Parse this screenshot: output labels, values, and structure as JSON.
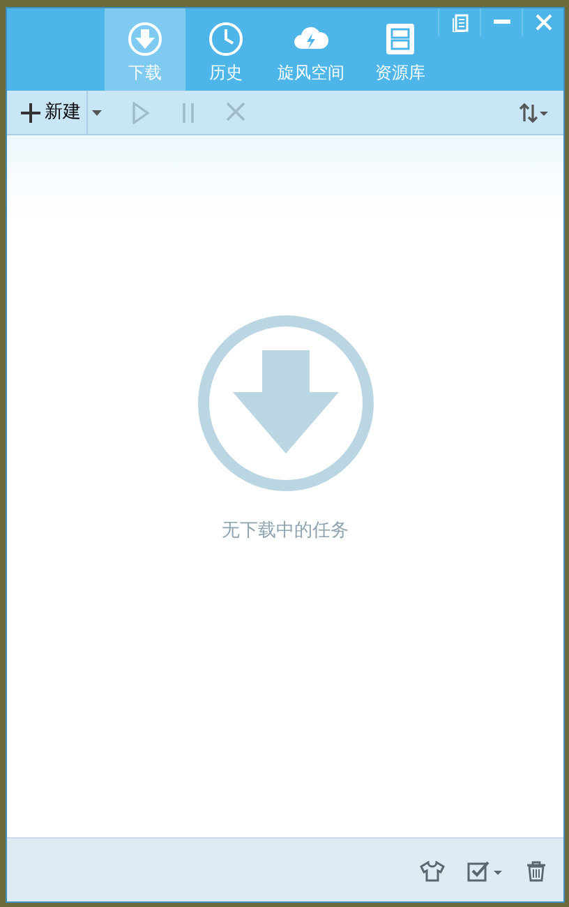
{
  "tabs": [
    {
      "label": "下载",
      "kind": "download",
      "selected": true
    },
    {
      "label": "历史",
      "kind": "history",
      "selected": false
    },
    {
      "label": "旋风空间",
      "kind": "cloud",
      "selected": false
    },
    {
      "label": "资源库",
      "kind": "cabinet",
      "selected": false
    }
  ],
  "toolbar": {
    "new_button": {
      "label": "新建"
    },
    "actions": [
      {
        "kind": "play",
        "disabled": true
      },
      {
        "kind": "pause",
        "disabled": true
      },
      {
        "kind": "stop",
        "disabled": true
      }
    ]
  },
  "empty_state": {
    "message": "无下载中的任务"
  }
}
